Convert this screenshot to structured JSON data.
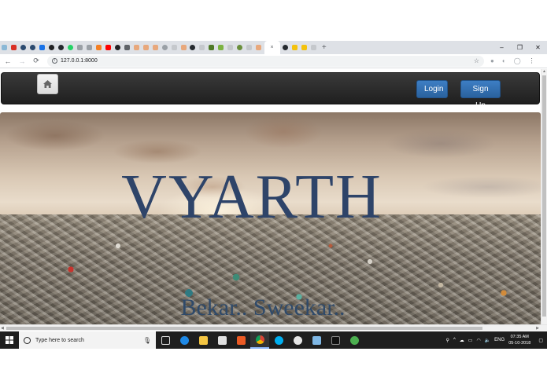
{
  "browser": {
    "tab_count": 40,
    "active_tab_close": "×",
    "new_tab": "+",
    "window_controls": [
      "–",
      "❐",
      "✕"
    ],
    "url": "127.0.0.1:8000",
    "nav": {
      "back": "←",
      "forward": "→",
      "reload": "⟳"
    }
  },
  "site": {
    "nav": {
      "login_label": "Login",
      "signup_label": "Sign Up"
    },
    "hero": {
      "title": "VYARTH",
      "tagline": "Bekar.. Sweekar.."
    }
  },
  "taskbar": {
    "search_placeholder": "Type here to search",
    "language": "ENG",
    "time": "07:35 AM",
    "date": "05-10-2018"
  },
  "colors": {
    "nav_bg": "#262626",
    "button_blue": "#2f6fae",
    "title_blue": "#2e4469",
    "taskbar_bg": "#1e1e1e"
  }
}
